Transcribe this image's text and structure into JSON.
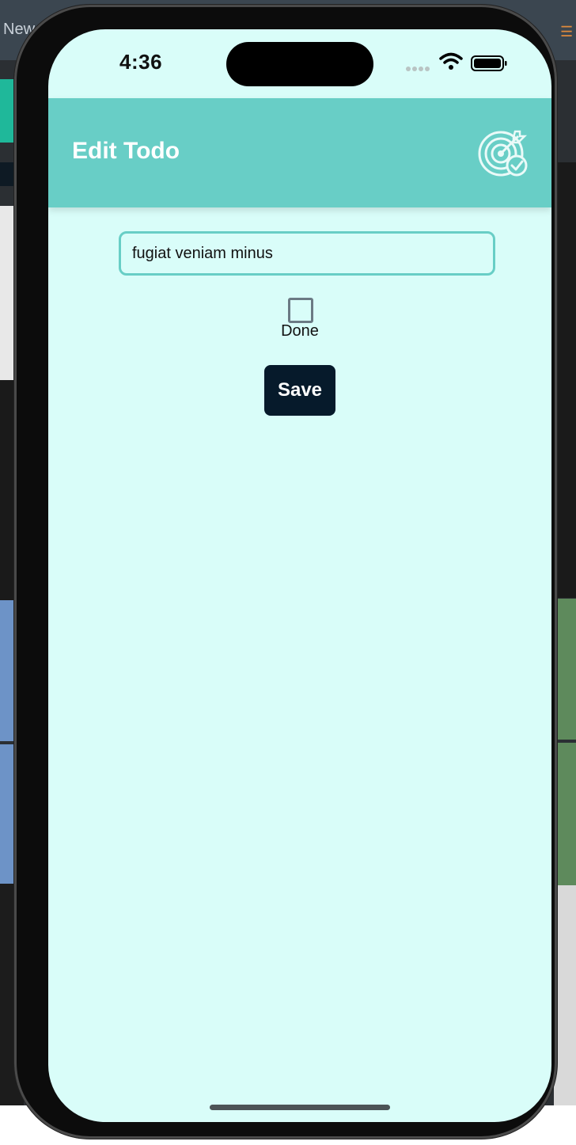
{
  "background": {
    "top_text": "New"
  },
  "status_bar": {
    "time": "4:36"
  },
  "header": {
    "title": "Edit Todo",
    "icon": "target-check-icon"
  },
  "form": {
    "todo_value": "fugiat veniam minus",
    "done_label": "Done",
    "done_checked": false,
    "save_label": "Save"
  },
  "colors": {
    "screen_bg": "#d9fdf9",
    "header_bg": "#68cec6",
    "button_bg": "#061a2b",
    "input_border": "#68cec6"
  }
}
